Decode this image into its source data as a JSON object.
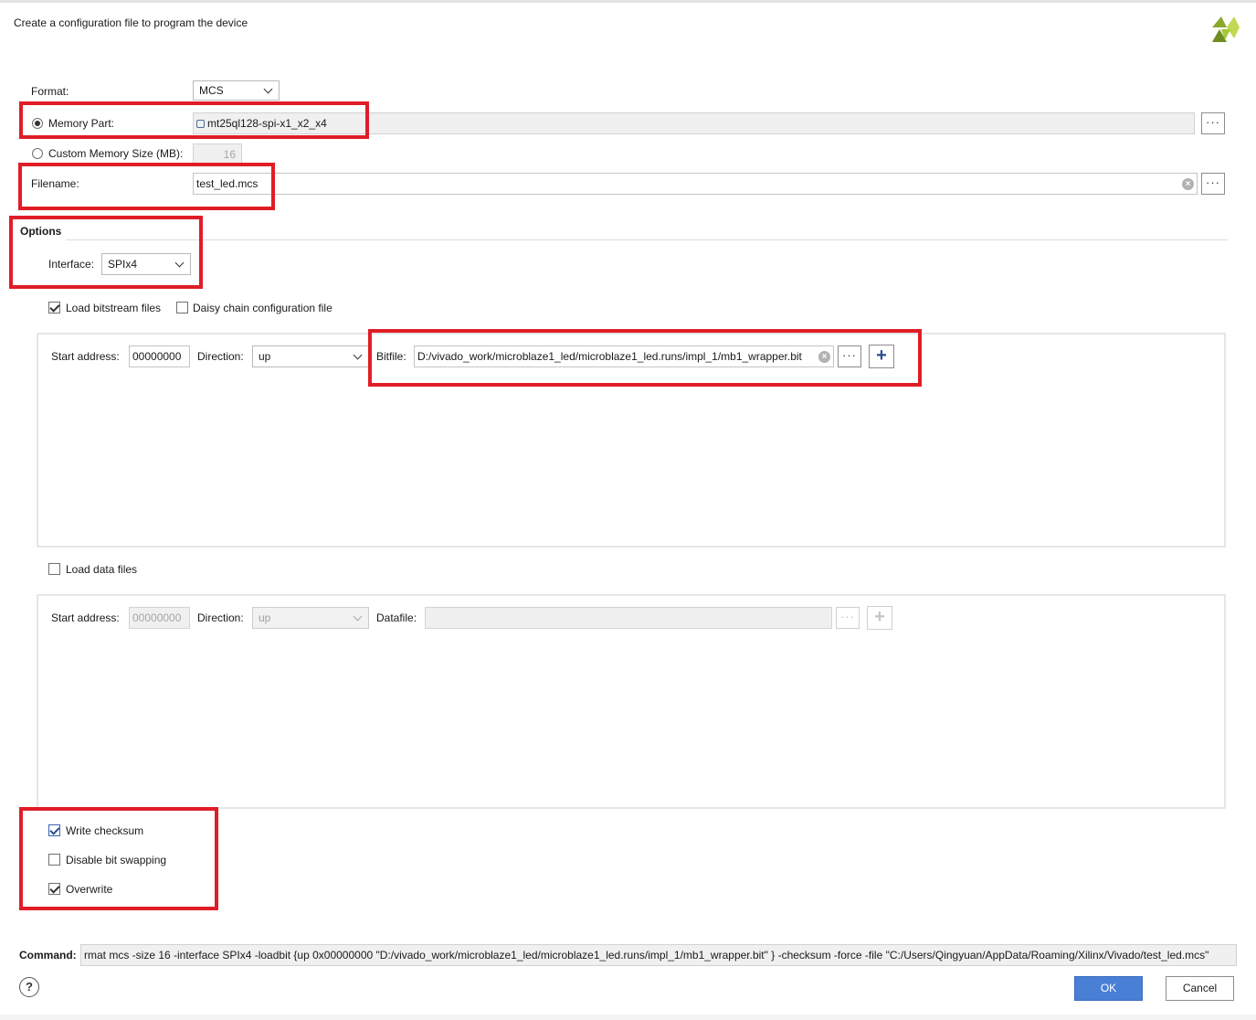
{
  "header": {
    "description": "Create a configuration file to program the device",
    "brand_logo": "xilinx-logo-icon"
  },
  "format": {
    "label": "Format:",
    "value": "MCS"
  },
  "memory_part": {
    "label": "Memory Part:",
    "value": "mt25ql128-spi-x1_x2_x4",
    "icon": "chip-icon",
    "selected": true
  },
  "custom_memory": {
    "label": "Custom Memory Size (MB):",
    "value": "16",
    "selected": false
  },
  "filename": {
    "label": "Filename:",
    "value": "test_led.mcs"
  },
  "options": {
    "title": "Options",
    "interface_label": "Interface:",
    "interface_value": "SPIx4",
    "load_bitstream_label": "Load bitstream files",
    "load_bitstream_checked": true,
    "daisy_chain_label": "Daisy chain configuration file",
    "daisy_chain_checked": false
  },
  "bitstream_row": {
    "start_address_label": "Start address:",
    "start_address_value": "00000000",
    "direction_label": "Direction:",
    "direction_value": "up",
    "bitfile_label": "Bitfile:",
    "bitfile_value": "D:/vivado_work/microblaze1_led/microblaze1_led.runs/impl_1/mb1_wrapper.bit"
  },
  "data_files": {
    "label": "Load data files",
    "checked": false
  },
  "data_row": {
    "start_address_label": "Start address:",
    "start_address_value": "00000000",
    "direction_label": "Direction:",
    "direction_value": "up",
    "datafile_label": "Datafile:",
    "datafile_value": ""
  },
  "checks": {
    "write_checksum": {
      "label": "Write checksum",
      "checked": true
    },
    "disable_bit_swapping": {
      "label": "Disable bit swapping",
      "checked": false
    },
    "overwrite": {
      "label": "Overwrite",
      "checked": true
    }
  },
  "command": {
    "label": "Command:",
    "value": "rmat mcs -size 16 -interface SPIx4 -loadbit {up 0x00000000 \"D:/vivado_work/microblaze1_led/microblaze1_led.runs/impl_1/mb1_wrapper.bit\" } -checksum -force -file \"C:/Users/Qingyuan/AppData/Roaming/Xilinx/Vivado/test_led.mcs\""
  },
  "footer": {
    "help_glyph": "?",
    "ok_label": "OK",
    "cancel_label": "Cancel"
  },
  "colors": {
    "highlight_red": "#e01d27",
    "primary_blue": "#4a7fd6",
    "logo_green": "#a4c639"
  }
}
